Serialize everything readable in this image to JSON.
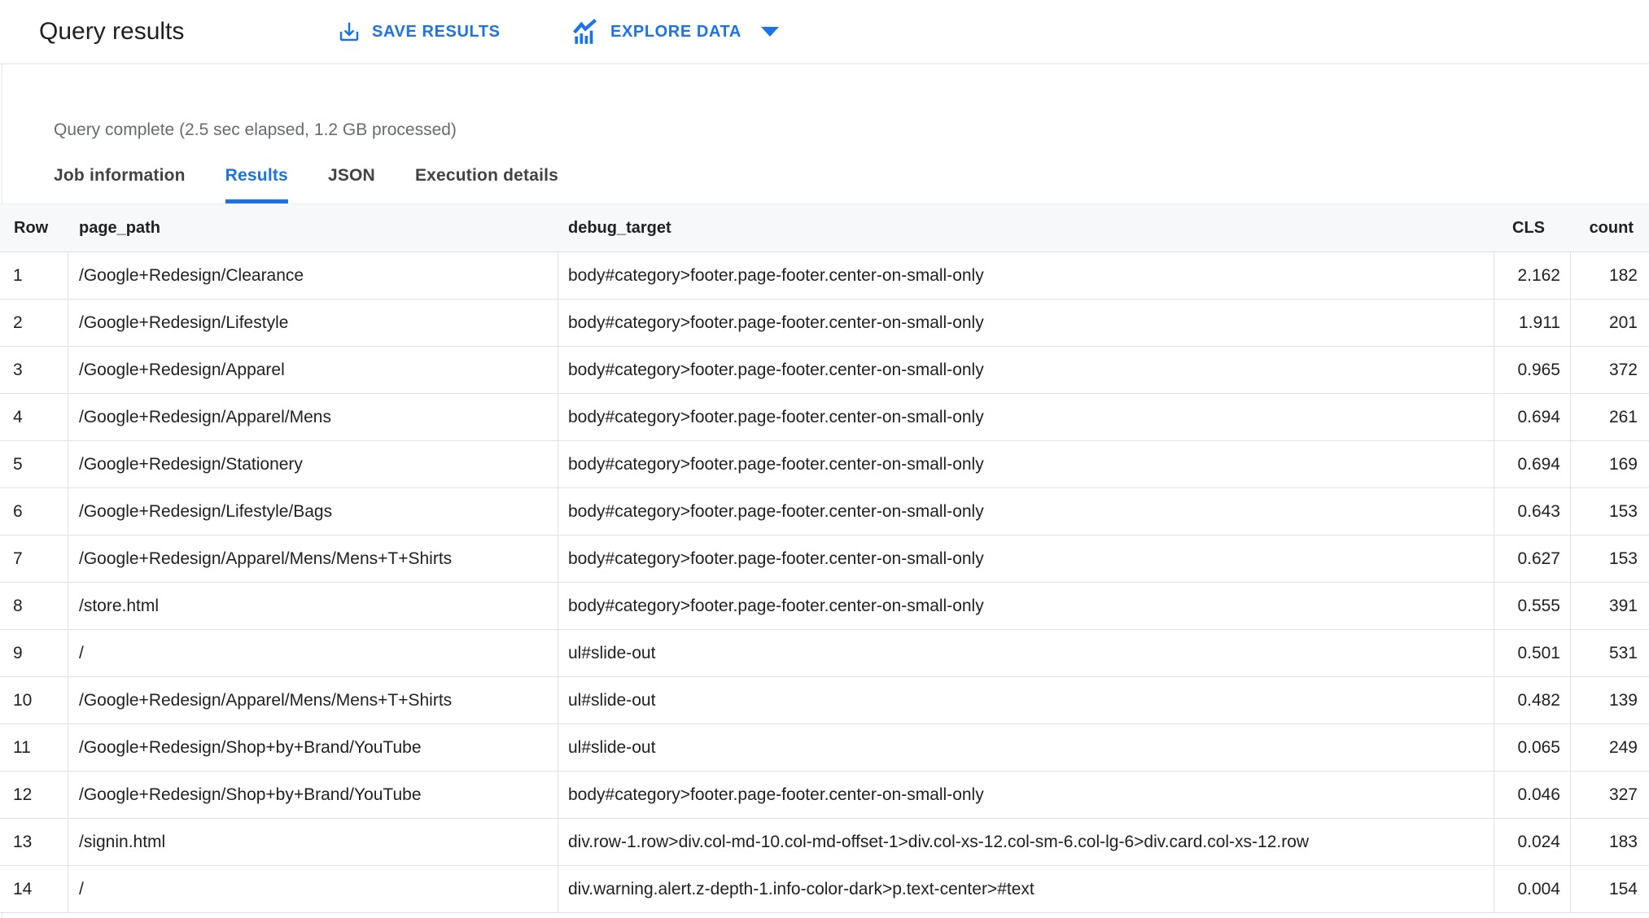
{
  "header": {
    "title": "Query results"
  },
  "toolbar": {
    "save_label": "SAVE RESULTS",
    "explore_label": "EXPLORE DATA"
  },
  "status": {
    "text": "Query complete (2.5 sec elapsed, 1.2 GB processed)"
  },
  "tabs": [
    {
      "label": "Job information",
      "active": false
    },
    {
      "label": "Results",
      "active": true
    },
    {
      "label": "JSON",
      "active": false
    },
    {
      "label": "Execution details",
      "active": false
    }
  ],
  "table": {
    "columns": [
      {
        "key": "row",
        "label": "Row",
        "align": "left"
      },
      {
        "key": "page_path",
        "label": "page_path",
        "align": "left"
      },
      {
        "key": "debug_target",
        "label": "debug_target",
        "align": "left"
      },
      {
        "key": "cls",
        "label": "CLS",
        "align": "right"
      },
      {
        "key": "count",
        "label": "count",
        "align": "right"
      }
    ],
    "rows": [
      {
        "row": "1",
        "page_path": "/Google+Redesign/Clearance",
        "debug_target": "body#category>footer.page-footer.center-on-small-only",
        "cls": "2.162",
        "count": "182"
      },
      {
        "row": "2",
        "page_path": "/Google+Redesign/Lifestyle",
        "debug_target": "body#category>footer.page-footer.center-on-small-only",
        "cls": "1.911",
        "count": "201"
      },
      {
        "row": "3",
        "page_path": "/Google+Redesign/Apparel",
        "debug_target": "body#category>footer.page-footer.center-on-small-only",
        "cls": "0.965",
        "count": "372"
      },
      {
        "row": "4",
        "page_path": "/Google+Redesign/Apparel/Mens",
        "debug_target": "body#category>footer.page-footer.center-on-small-only",
        "cls": "0.694",
        "count": "261"
      },
      {
        "row": "5",
        "page_path": "/Google+Redesign/Stationery",
        "debug_target": "body#category>footer.page-footer.center-on-small-only",
        "cls": "0.694",
        "count": "169"
      },
      {
        "row": "6",
        "page_path": "/Google+Redesign/Lifestyle/Bags",
        "debug_target": "body#category>footer.page-footer.center-on-small-only",
        "cls": "0.643",
        "count": "153"
      },
      {
        "row": "7",
        "page_path": "/Google+Redesign/Apparel/Mens/Mens+T+Shirts",
        "debug_target": "body#category>footer.page-footer.center-on-small-only",
        "cls": "0.627",
        "count": "153"
      },
      {
        "row": "8",
        "page_path": "/store.html",
        "debug_target": "body#category>footer.page-footer.center-on-small-only",
        "cls": "0.555",
        "count": "391"
      },
      {
        "row": "9",
        "page_path": "/",
        "debug_target": "ul#slide-out",
        "cls": "0.501",
        "count": "531"
      },
      {
        "row": "10",
        "page_path": "/Google+Redesign/Apparel/Mens/Mens+T+Shirts",
        "debug_target": "ul#slide-out",
        "cls": "0.482",
        "count": "139"
      },
      {
        "row": "11",
        "page_path": "/Google+Redesign/Shop+by+Brand/YouTube",
        "debug_target": "ul#slide-out",
        "cls": "0.065",
        "count": "249"
      },
      {
        "row": "12",
        "page_path": "/Google+Redesign/Shop+by+Brand/YouTube",
        "debug_target": "body#category>footer.page-footer.center-on-small-only",
        "cls": "0.046",
        "count": "327"
      },
      {
        "row": "13",
        "page_path": "/signin.html",
        "debug_target": "div.row-1.row>div.col-md-10.col-md-offset-1>div.col-xs-12.col-sm-6.col-lg-6>div.card.col-xs-12.row",
        "cls": "0.024",
        "count": "183"
      },
      {
        "row": "14",
        "page_path": "/",
        "debug_target": "div.warning.alert.z-depth-1.info-color-dark>p.text-center>#text",
        "cls": "0.004",
        "count": "154"
      }
    ]
  },
  "colors": {
    "accent": "#1a73e8",
    "text": "#202124",
    "muted": "#686b6e",
    "border": "#e0e0e0",
    "header_bg": "#f7f8f9"
  }
}
